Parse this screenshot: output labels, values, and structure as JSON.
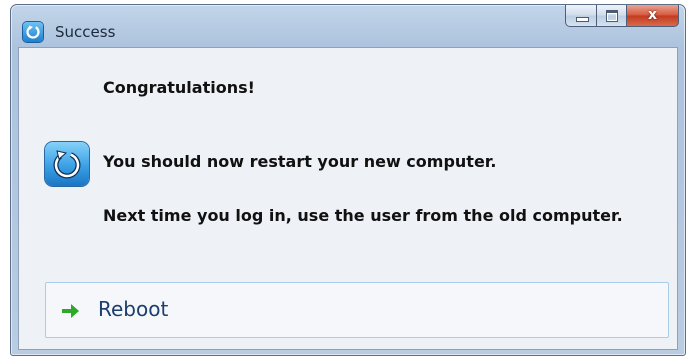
{
  "window": {
    "title": "Success",
    "close_glyph": "x"
  },
  "content": {
    "heading": "Congratulations!",
    "message_1": "You should now restart your new computer.",
    "message_2": "Next time you log in, use the user from the old computer."
  },
  "actions": {
    "reboot_label": "Reboot"
  },
  "icons": {
    "title_icon": "app-restart-icon",
    "main_icon": "restart-icon",
    "reboot_icon": "green-arrow-right-icon"
  },
  "colors": {
    "link_text": "#1b3e6e",
    "arrow_green": "#2fa82a",
    "close_red": "#c23a1d"
  }
}
